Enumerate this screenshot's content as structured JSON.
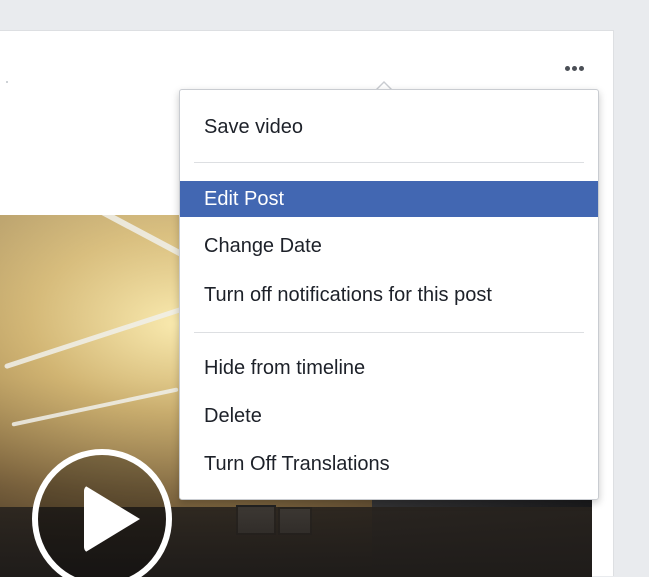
{
  "post": {
    "more_icon": "ellipsis-horizontal-icon"
  },
  "video": {
    "play_icon": "play-icon"
  },
  "menu": {
    "highlight_color": "#4267b2",
    "items": [
      {
        "label": "Save video"
      },
      {
        "label": "Edit Post",
        "highlighted": true
      },
      {
        "label": "Change Date"
      },
      {
        "label": "Turn off notifications for this post"
      },
      {
        "label": "Hide from timeline"
      },
      {
        "label": "Delete"
      },
      {
        "label": "Turn Off Translations"
      }
    ]
  }
}
